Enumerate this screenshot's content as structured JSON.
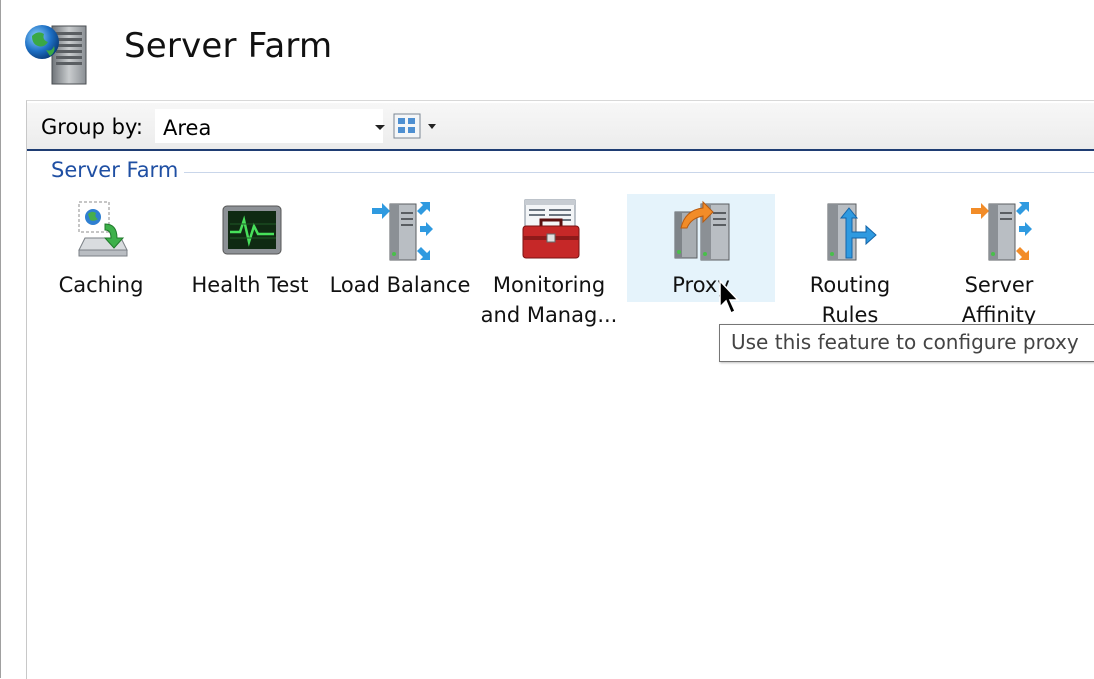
{
  "header": {
    "title": "Server Farm",
    "icon": "server-farm-globe-icon"
  },
  "toolbar": {
    "group_by_label": "Group by:",
    "group_by_value": "Area",
    "view_button_icon": "view-mode-icon"
  },
  "section": {
    "title": "Server Farm"
  },
  "features": [
    {
      "label_line1": "Caching",
      "label_line2": "",
      "icon": "caching-icon"
    },
    {
      "label_line1": "Health Test",
      "label_line2": "",
      "icon": "health-test-icon"
    },
    {
      "label_line1": "Load Balance",
      "label_line2": "",
      "icon": "load-balance-icon"
    },
    {
      "label_line1": "Monitoring",
      "label_line2": "and Manag...",
      "icon": "monitoring-toolbox-icon"
    },
    {
      "label_line1": "Proxy",
      "label_line2": "",
      "icon": "proxy-icon",
      "hovered": true
    },
    {
      "label_line1": "Routing",
      "label_line2": "Rules",
      "icon": "routing-rules-icon"
    },
    {
      "label_line1": "Server",
      "label_line2": "Affinity",
      "icon": "server-affinity-icon"
    }
  ],
  "tooltip": {
    "text": "Use this feature to configure proxy"
  },
  "colors": {
    "accent_text": "#1f4fa3",
    "toolbar_underline": "#1f3d73",
    "hover_background": "#e5f3fb"
  }
}
